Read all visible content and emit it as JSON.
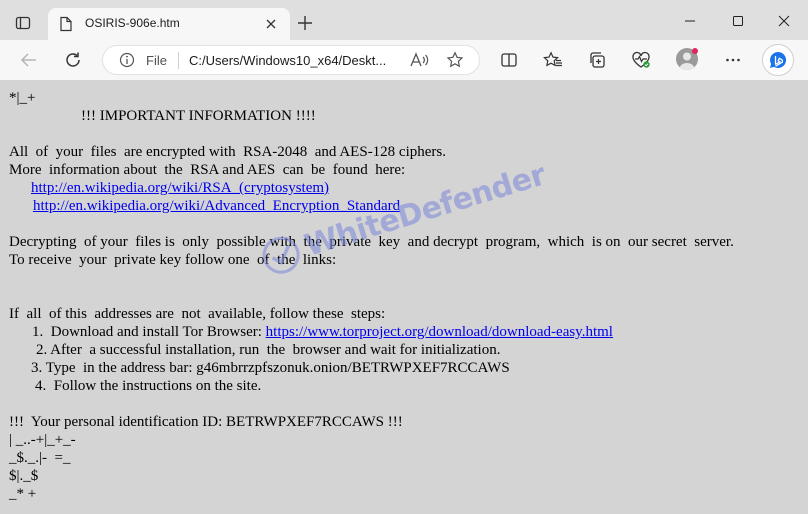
{
  "browser": {
    "tab_title": "OSIRIS-906e.htm",
    "address_scheme": "File",
    "address_url": "C:/Users/Windows10_x64/Deskt...",
    "colors": {
      "link": "#0000ee",
      "page_bg": "#d4d4d4",
      "watermark": "#7a86d8",
      "bing": "#1a73e8"
    }
  },
  "icons": {
    "tab_actions": "tab-actions-icon",
    "page": "page-icon",
    "close_tab": "close-icon",
    "new_tab": "plus-icon",
    "back": "back-arrow-icon",
    "refresh": "refresh-icon",
    "info": "info-icon",
    "read_aloud": "read-aloud-icon",
    "favorite": "star-icon",
    "split": "split-screen-icon",
    "favorites_bar": "favorites-icon",
    "collections": "collections-icon",
    "health": "browser-essentials-icon",
    "profile": "profile-icon",
    "more": "more-icon",
    "bing": "bing-icon"
  },
  "note": {
    "l1": "*|_+",
    "heading": "!!! IMPORTANT INFORMATION !!!!",
    "l3": "All  of  your  files  are encrypted with  RSA-2048  and AES-128 ciphers.",
    "l4": "More  information about  the  RSA and AES  can  be  found  here:",
    "link1": "http://en.wikipedia.org/wiki/RSA_(cryptosystem)",
    "link2": "http://en.wikipedia.org/wiki/Advanced_Encryption_Standard",
    "l7": "Decrypting  of your  files is  only  possible with  the  private  key  and decrypt  program,  which  is on  our secret  server.",
    "l8": "To receive  your  private key follow one  of  the  links:",
    "l9": "If  all  of this  addresses are  not  available, follow these  steps:",
    "step1_prefix": "1.  Download and install Tor Browser: ",
    "step1_link": "https://www.torproject.org/download/download-easy.html",
    "step2": "2. After  a successful installation, run  the  browser and wait for initialization.",
    "step3": "3. Type  in the address bar: g46mbrrzpfszonuk.onion/BETRWPXEF7RCCAWS",
    "step4": "4.  Follow the instructions on the site.",
    "id_line": "!!!  Your personal identification ID: BETRWPXEF7RCCAWS !!!",
    "art1": "| _..-+|_+_-",
    "art2": "_$._.|-  =_",
    "art3": "$|._$",
    "art4": "_* +"
  },
  "watermark": {
    "text": "WhiteDefender"
  }
}
